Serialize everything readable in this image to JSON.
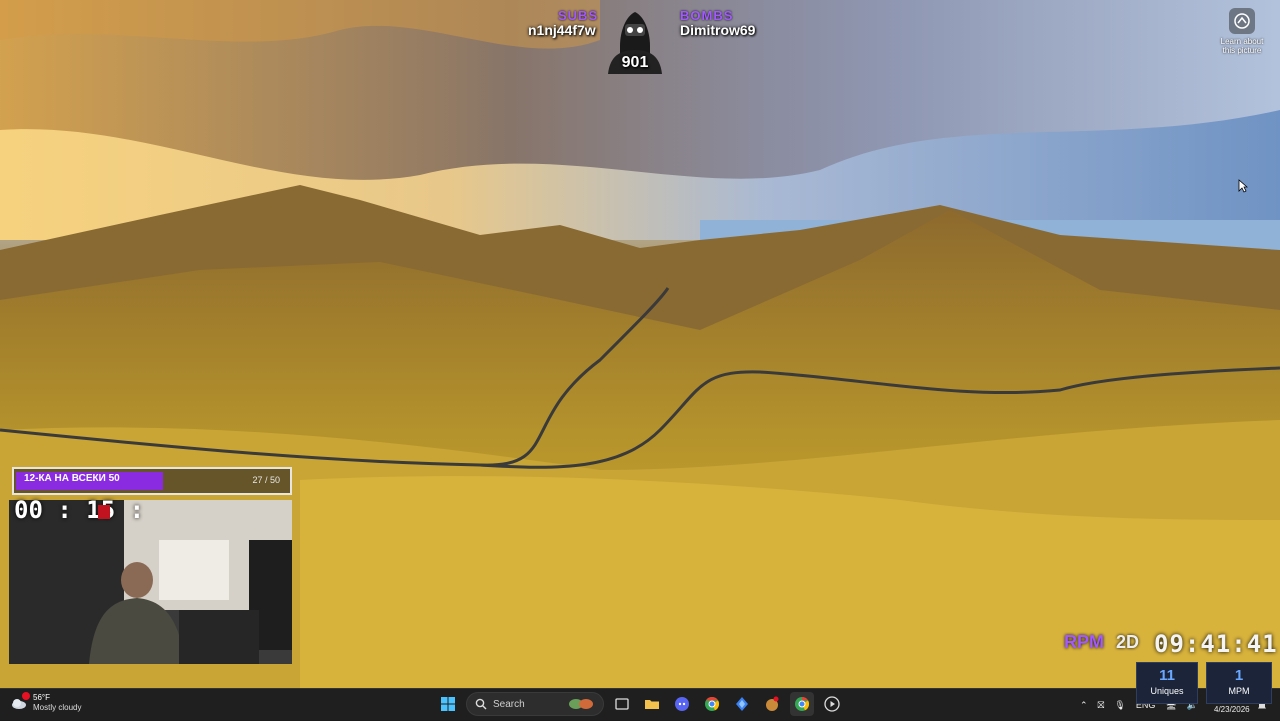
{
  "overlay": {
    "subs_label": "SUBS",
    "subs_name": "n1nj44f7w",
    "bombs_label": "BOMBS",
    "bombs_name": "Dimitrow69",
    "mascot_count": "901"
  },
  "learn": {
    "text": "Learn about this picture",
    "icon": "camera-icon"
  },
  "goal": {
    "title": "12-КА НА ВСЕКИ 50",
    "count_text": "27 / 50",
    "progress": 0.54,
    "color": "#8a2be2"
  },
  "timer": {
    "text": "00 : 15 :"
  },
  "stream_stats": {
    "rpm_label": "RPM",
    "mode_label": "2D",
    "clock": "09:41:41",
    "uniques_value": "11",
    "uniques_label": "Uniques",
    "mpm_value": "1",
    "mpm_label": "MPM"
  },
  "taskbar": {
    "weather_temp": "56°F",
    "weather_desc": "Mostly cloudy",
    "search_label": "Search",
    "apps": [
      "start-icon",
      "search-icon",
      "task-view-icon",
      "file-explorer-icon",
      "discord-icon",
      "chrome-icon",
      "dev-tool-icon",
      "game-icon",
      "chrome-icon",
      "media-player-icon"
    ],
    "language": "ENG",
    "date": "4/23/2026"
  },
  "colors": {
    "accent": "#a259ff",
    "taskbar": "#1f1f1f",
    "stat_box": "#1b2438"
  }
}
